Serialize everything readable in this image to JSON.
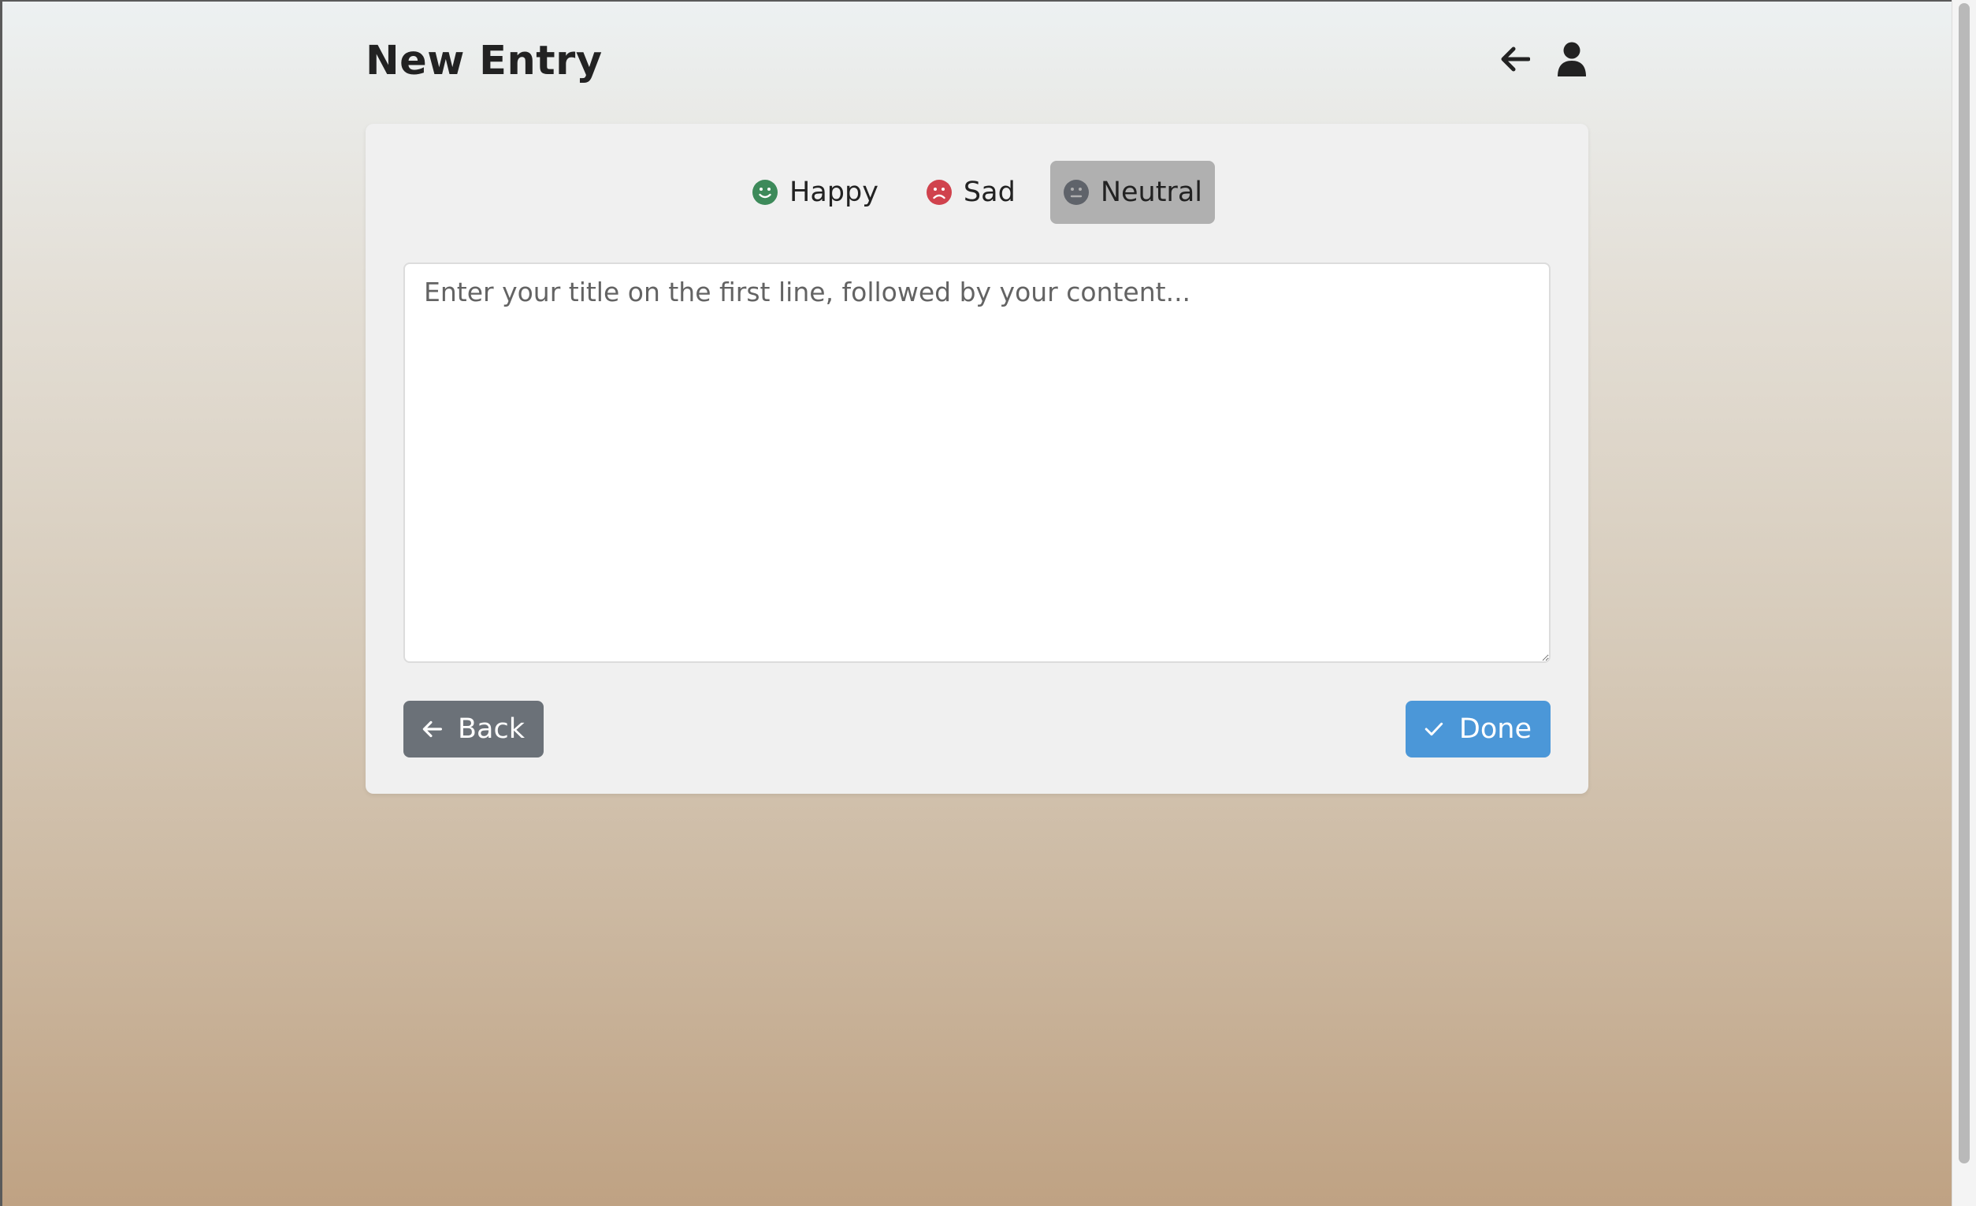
{
  "header": {
    "title": "New Entry",
    "back_icon": "arrow-left-icon",
    "profile_icon": "user-icon"
  },
  "moods": [
    {
      "label": "Happy",
      "icon": "smile-icon",
      "color": "#3d8a5a",
      "selected": false
    },
    {
      "label": "Sad",
      "icon": "frown-icon",
      "color": "#d0424d",
      "selected": false
    },
    {
      "label": "Neutral",
      "icon": "neutral-face-icon",
      "color": "#5f636a",
      "selected": true
    }
  ],
  "editor": {
    "placeholder": "Enter your title on the first line, followed by your content...",
    "value": ""
  },
  "actions": {
    "back_label": "Back",
    "back_icon": "arrow-left-icon",
    "done_label": "Done",
    "done_icon": "check-icon"
  },
  "colors": {
    "done_button": "#4b97d8",
    "back_button": "#6b7178",
    "selected_mood_bg": "#b0b0b0",
    "card_bg": "#f0f0f0"
  }
}
